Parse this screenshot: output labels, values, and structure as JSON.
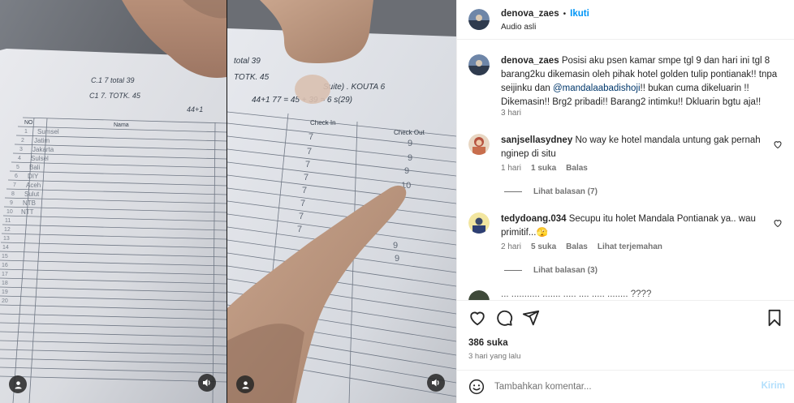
{
  "post": {
    "username": "denova_zaes",
    "separator": "•",
    "follow_label": "Ikuti",
    "audio_label": "Audio asli"
  },
  "caption": {
    "username": "denova_zaes",
    "text_1": "Posisi aku psen kamar smpe tgl 9 dan hari ini tgl 8 barang2ku dikemasin oleh pihak hotel golden tulip pontianak!! tnpa seijinku dan ",
    "mention": "@mandalaabadishoji",
    "text_2": "!! bukan cuma dikeluarin !! Dikemasin!! Brg2 pribadi!! Barang2 intimku!! Dkluarin bgtu aja!!",
    "time": "3 hari"
  },
  "comments": [
    {
      "username": "sanjsellasydney",
      "text": "No way ke hotel mandala untung gak pernah nginep di situ",
      "time": "1 hari",
      "likes": "1 suka",
      "reply": "Balas",
      "translate": "",
      "view_replies": "Lihat balasan (7)"
    },
    {
      "username": "tedydoang.034",
      "text": "Secupu itu holet Mandala Pontianak ya.. wau primitif...🫣",
      "time": "2 hari",
      "likes": "5 suka",
      "reply": "Balas",
      "translate": "Lihat terjemahan",
      "view_replies": "Lihat balasan (3)"
    },
    {
      "partial_text": "... ........... ....... ..... .... ..... ........ ????"
    }
  ],
  "stats": {
    "likes": "386 suka",
    "date": "3 hari yang lalu"
  },
  "composer": {
    "placeholder": "Tambahkan komentar...",
    "send_label": "Kirim"
  },
  "icons": {
    "emoji": "emoji-icon",
    "like": "heart-icon",
    "comment": "comment-icon",
    "share": "send-icon",
    "save": "bookmark-icon",
    "user": "user-tag-icon",
    "audio": "speaker-icon"
  },
  "colors": {
    "accent": "#0095f6",
    "text": "#262626",
    "muted": "#737373",
    "link": "#00376b"
  },
  "media": {
    "left_frame": {
      "header_1": "C.1  7   total  39",
      "header_2": "C1  7.   TOTK.  45",
      "header_3": "44+1",
      "column_no": "NO",
      "column_name": "Nama",
      "rows": [
        "1",
        "2",
        "3",
        "4",
        "5",
        "6",
        "7",
        "8",
        "9",
        "10",
        "11",
        "12",
        "13",
        "14",
        "15",
        "16",
        "17",
        "18",
        "19",
        "20"
      ],
      "names": [
        "Sumsel",
        "Jatim",
        "Jakarta",
        "Sulsel",
        "Bali",
        "DIY",
        "Aceh",
        "Sulut",
        "NTB",
        "NTT"
      ]
    },
    "right_frame": {
      "header_1": "total  39",
      "header_2": "TOTK.  45",
      "header_3": "Suite) . KOUTA  6",
      "header_4": "44+1    77 = 45 + 39 = 6 s(29)",
      "column_in": "Check In",
      "column_out": "Check Out",
      "checkin_marks": [
        "7",
        "7",
        "7",
        "7",
        "7",
        "7",
        "7",
        "7"
      ],
      "checkout_marks": [
        "9",
        "9",
        "9",
        "10",
        "9",
        "9"
      ]
    }
  }
}
